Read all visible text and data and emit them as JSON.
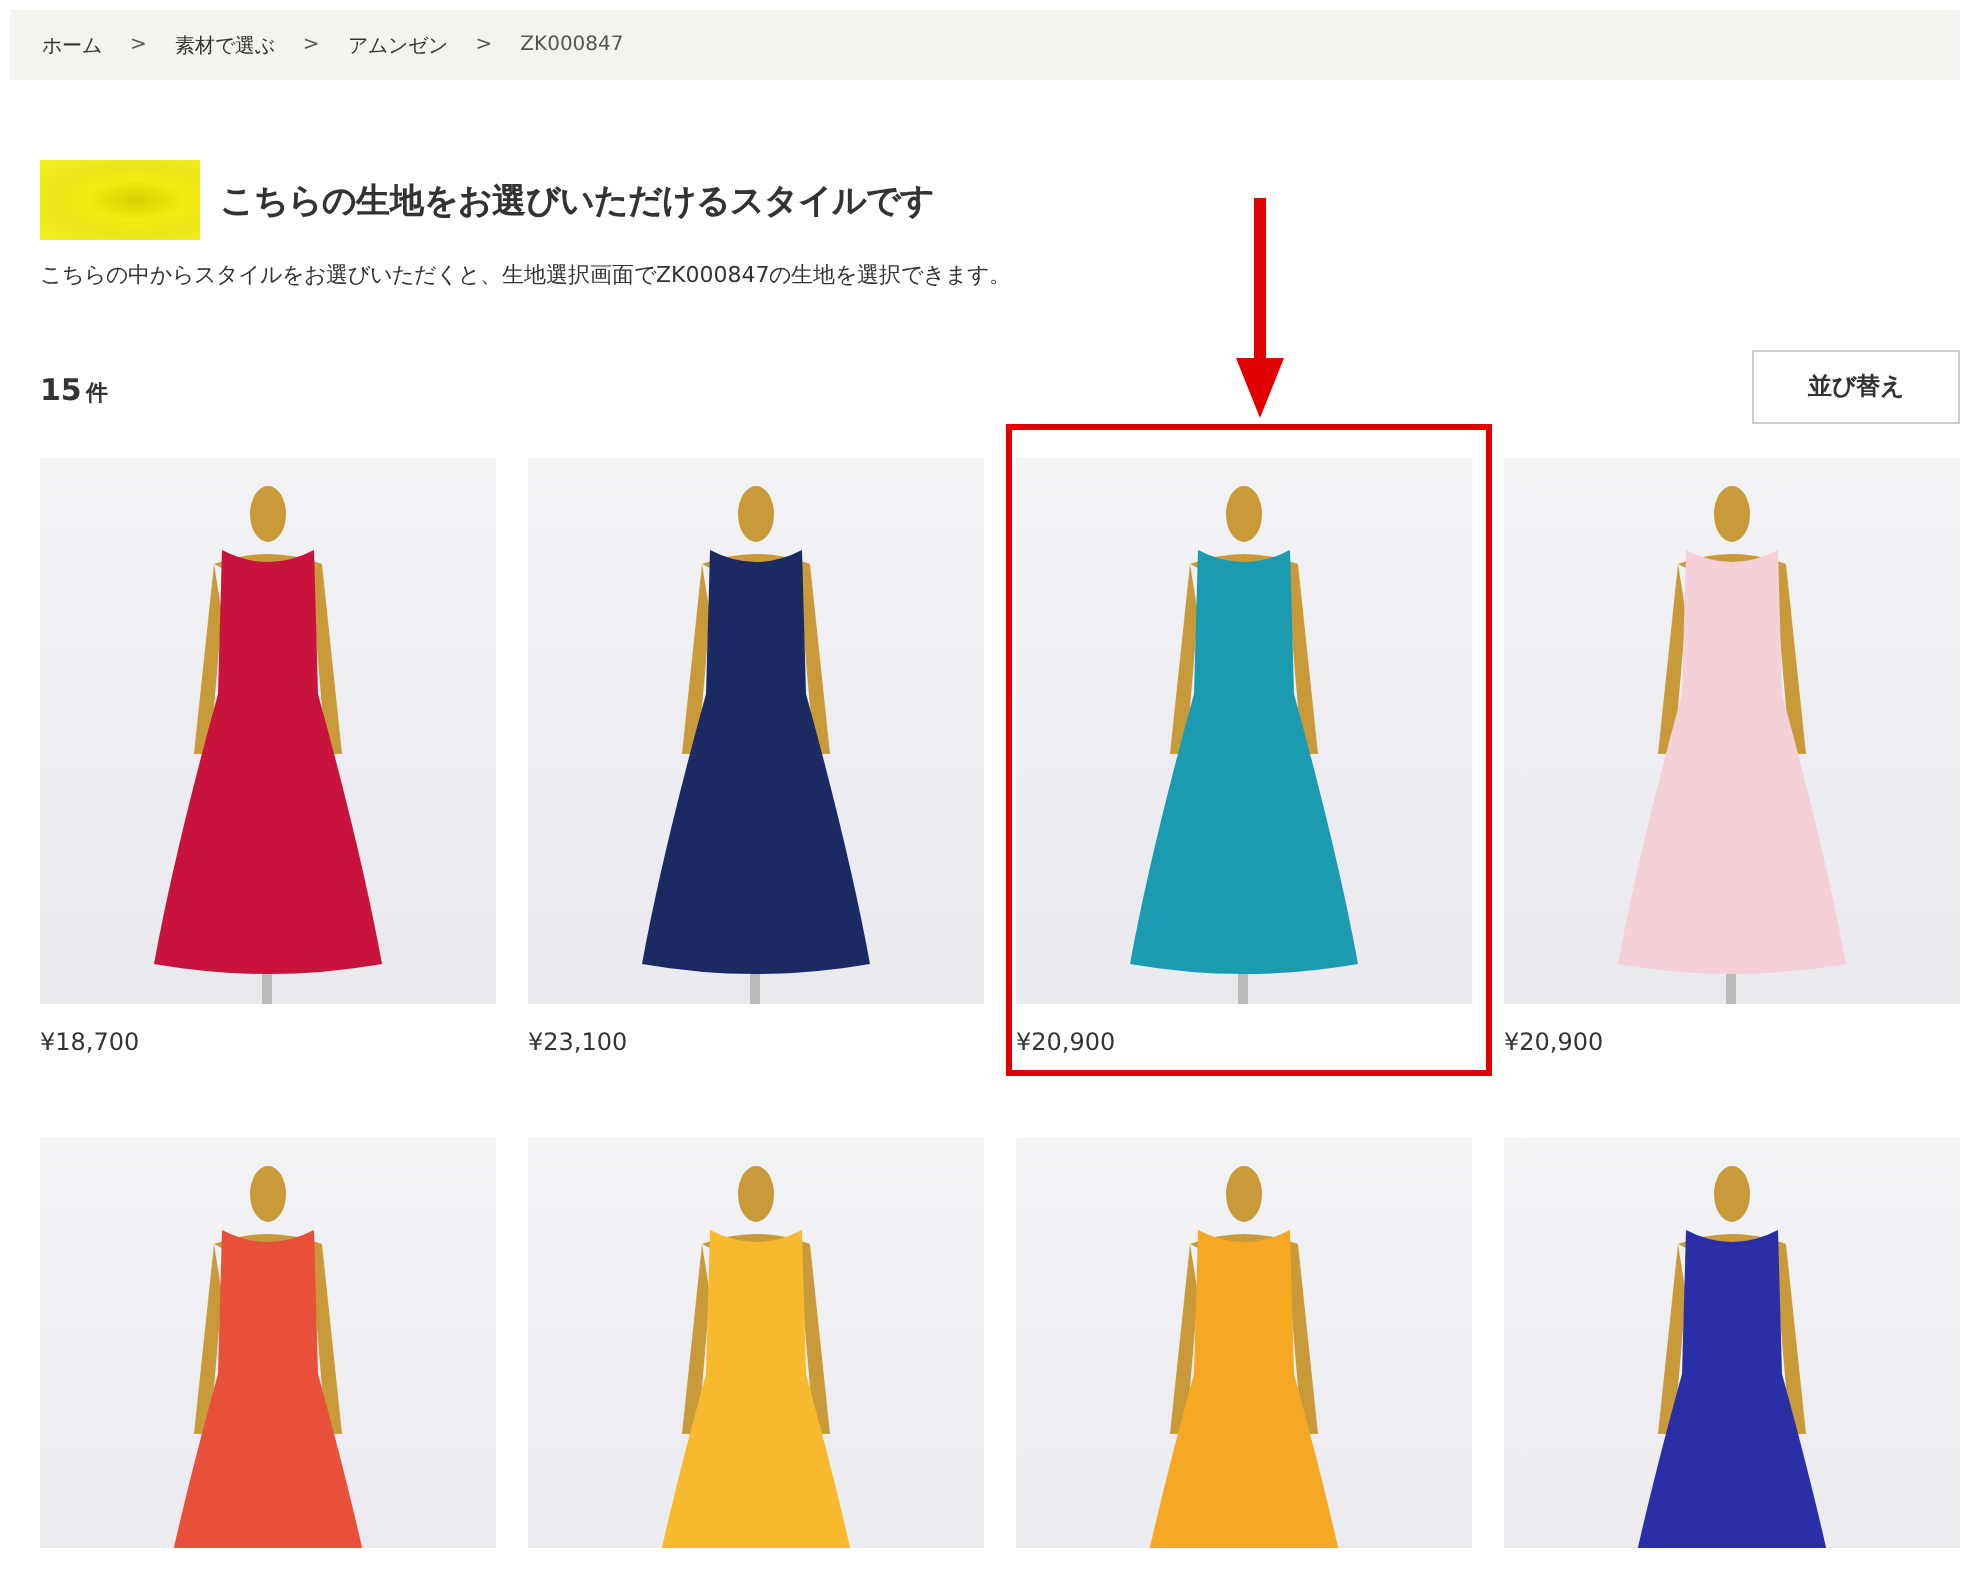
{
  "breadcrumb": [
    "ホーム",
    "素材で選ぶ",
    "アムンゼン",
    "ZK000847"
  ],
  "breadcrumb_separator": ">",
  "heading": "こちらの生地をお選びいただけるスタイルです",
  "description": "こちらの中からスタイルをお選びいただくと、生地選択画面でZK000847の生地を選択できます。",
  "count": {
    "number": "15",
    "unit": "件"
  },
  "sort_button": "並び替え",
  "products": [
    {
      "price": "¥18,700",
      "color": "#c8143c",
      "highlighted": false
    },
    {
      "price": "¥23,100",
      "color": "#1c2a63",
      "highlighted": false
    },
    {
      "price": "¥20,900",
      "color": "#1a9bb0",
      "highlighted": true
    },
    {
      "price": "¥20,900",
      "color": "#f6d0d8",
      "highlighted": false
    },
    {
      "color": "#e8503a",
      "highlighted": false
    },
    {
      "color": "#f7b92e",
      "highlighted": false
    },
    {
      "color": "#f5a823",
      "highlighted": false
    },
    {
      "color": "#2a2fa8",
      "highlighted": false
    }
  ]
}
